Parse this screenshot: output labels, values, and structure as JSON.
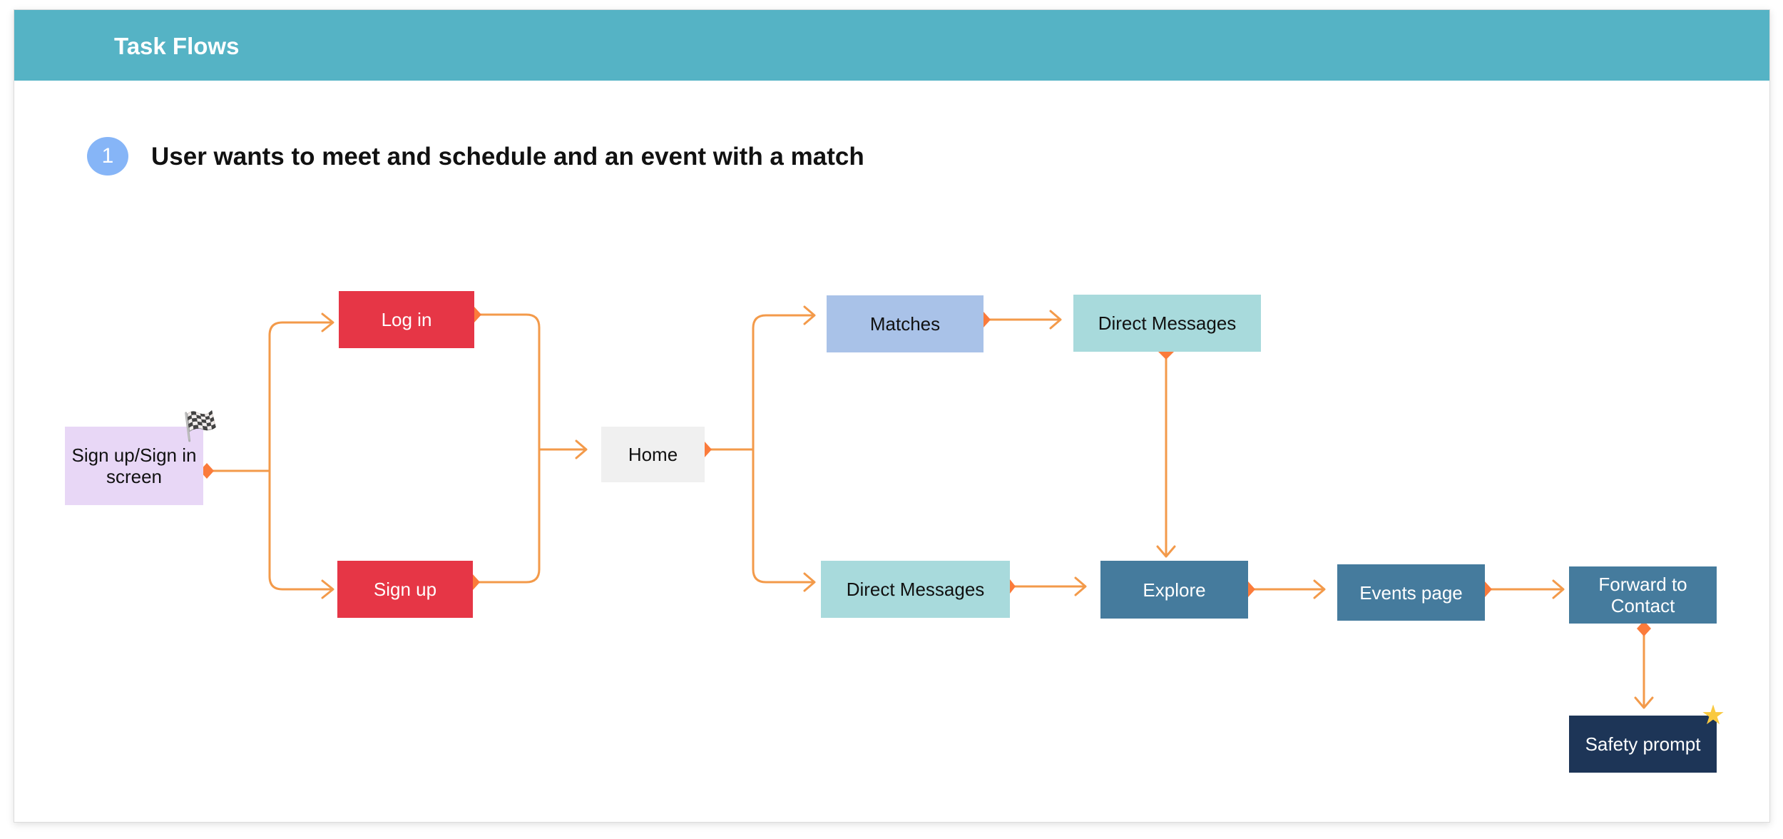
{
  "header": {
    "title": "Task Flows"
  },
  "flow": {
    "number": "1",
    "title": "User wants to meet and schedule and an event with a match"
  },
  "nodes": {
    "start": {
      "label": "Sign up/Sign in screen",
      "color": "#e8d7f6"
    },
    "login": {
      "label": "Log in",
      "color": "#e63646"
    },
    "signup": {
      "label": "Sign up",
      "color": "#e63646"
    },
    "home": {
      "label": "Home",
      "color": "#f0f0f0"
    },
    "matches": {
      "label": "Matches",
      "color": "#a9c2e8"
    },
    "dm_top": {
      "label": "Direct Messages",
      "color": "#a8dadc"
    },
    "dm_bottom": {
      "label": "Direct Messages",
      "color": "#a8dadc"
    },
    "explore": {
      "label": "Explore",
      "color": "#457b9d"
    },
    "events": {
      "label": "Events page",
      "color": "#457b9d"
    },
    "forward": {
      "label": "Forward to Contact",
      "color": "#457b9d"
    },
    "safety": {
      "label": "Safety prompt",
      "color": "#1d3557"
    }
  },
  "edges": [
    [
      "start",
      "login"
    ],
    [
      "start",
      "signup"
    ],
    [
      "login",
      "home"
    ],
    [
      "signup",
      "home"
    ],
    [
      "home",
      "matches"
    ],
    [
      "home",
      "dm_bottom"
    ],
    [
      "matches",
      "dm_top"
    ],
    [
      "dm_top",
      "explore"
    ],
    [
      "dm_bottom",
      "explore"
    ],
    [
      "explore",
      "events"
    ],
    [
      "events",
      "forward"
    ],
    [
      "forward",
      "safety"
    ]
  ],
  "icons": {
    "start_marker": "checkered-flag-icon",
    "end_marker": "star-icon"
  },
  "colors": {
    "header": "#55b3c5",
    "connector": "#f39a4a",
    "connector_dot": "#fb7b3b",
    "badge": "#86b5f7"
  }
}
